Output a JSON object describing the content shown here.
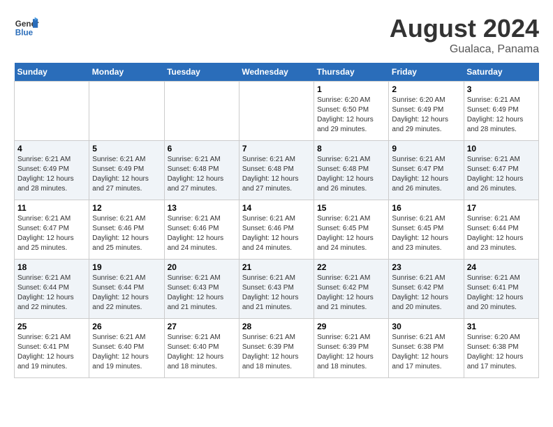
{
  "header": {
    "logo_line1": "General",
    "logo_line2": "Blue",
    "month_year": "August 2024",
    "location": "Gualaca, Panama"
  },
  "days_of_week": [
    "Sunday",
    "Monday",
    "Tuesday",
    "Wednesday",
    "Thursday",
    "Friday",
    "Saturday"
  ],
  "weeks": [
    [
      {
        "day": "",
        "sunrise": "",
        "sunset": "",
        "daylight": ""
      },
      {
        "day": "",
        "sunrise": "",
        "sunset": "",
        "daylight": ""
      },
      {
        "day": "",
        "sunrise": "",
        "sunset": "",
        "daylight": ""
      },
      {
        "day": "",
        "sunrise": "",
        "sunset": "",
        "daylight": ""
      },
      {
        "day": "1",
        "sunrise": "6:20 AM",
        "sunset": "6:50 PM",
        "daylight": "12 hours and 29 minutes."
      },
      {
        "day": "2",
        "sunrise": "6:20 AM",
        "sunset": "6:49 PM",
        "daylight": "12 hours and 29 minutes."
      },
      {
        "day": "3",
        "sunrise": "6:21 AM",
        "sunset": "6:49 PM",
        "daylight": "12 hours and 28 minutes."
      }
    ],
    [
      {
        "day": "4",
        "sunrise": "6:21 AM",
        "sunset": "6:49 PM",
        "daylight": "12 hours and 28 minutes."
      },
      {
        "day": "5",
        "sunrise": "6:21 AM",
        "sunset": "6:49 PM",
        "daylight": "12 hours and 27 minutes."
      },
      {
        "day": "6",
        "sunrise": "6:21 AM",
        "sunset": "6:48 PM",
        "daylight": "12 hours and 27 minutes."
      },
      {
        "day": "7",
        "sunrise": "6:21 AM",
        "sunset": "6:48 PM",
        "daylight": "12 hours and 27 minutes."
      },
      {
        "day": "8",
        "sunrise": "6:21 AM",
        "sunset": "6:48 PM",
        "daylight": "12 hours and 26 minutes."
      },
      {
        "day": "9",
        "sunrise": "6:21 AM",
        "sunset": "6:47 PM",
        "daylight": "12 hours and 26 minutes."
      },
      {
        "day": "10",
        "sunrise": "6:21 AM",
        "sunset": "6:47 PM",
        "daylight": "12 hours and 26 minutes."
      }
    ],
    [
      {
        "day": "11",
        "sunrise": "6:21 AM",
        "sunset": "6:47 PM",
        "daylight": "12 hours and 25 minutes."
      },
      {
        "day": "12",
        "sunrise": "6:21 AM",
        "sunset": "6:46 PM",
        "daylight": "12 hours and 25 minutes."
      },
      {
        "day": "13",
        "sunrise": "6:21 AM",
        "sunset": "6:46 PM",
        "daylight": "12 hours and 24 minutes."
      },
      {
        "day": "14",
        "sunrise": "6:21 AM",
        "sunset": "6:46 PM",
        "daylight": "12 hours and 24 minutes."
      },
      {
        "day": "15",
        "sunrise": "6:21 AM",
        "sunset": "6:45 PM",
        "daylight": "12 hours and 24 minutes."
      },
      {
        "day": "16",
        "sunrise": "6:21 AM",
        "sunset": "6:45 PM",
        "daylight": "12 hours and 23 minutes."
      },
      {
        "day": "17",
        "sunrise": "6:21 AM",
        "sunset": "6:44 PM",
        "daylight": "12 hours and 23 minutes."
      }
    ],
    [
      {
        "day": "18",
        "sunrise": "6:21 AM",
        "sunset": "6:44 PM",
        "daylight": "12 hours and 22 minutes."
      },
      {
        "day": "19",
        "sunrise": "6:21 AM",
        "sunset": "6:44 PM",
        "daylight": "12 hours and 22 minutes."
      },
      {
        "day": "20",
        "sunrise": "6:21 AM",
        "sunset": "6:43 PM",
        "daylight": "12 hours and 21 minutes."
      },
      {
        "day": "21",
        "sunrise": "6:21 AM",
        "sunset": "6:43 PM",
        "daylight": "12 hours and 21 minutes."
      },
      {
        "day": "22",
        "sunrise": "6:21 AM",
        "sunset": "6:42 PM",
        "daylight": "12 hours and 21 minutes."
      },
      {
        "day": "23",
        "sunrise": "6:21 AM",
        "sunset": "6:42 PM",
        "daylight": "12 hours and 20 minutes."
      },
      {
        "day": "24",
        "sunrise": "6:21 AM",
        "sunset": "6:41 PM",
        "daylight": "12 hours and 20 minutes."
      }
    ],
    [
      {
        "day": "25",
        "sunrise": "6:21 AM",
        "sunset": "6:41 PM",
        "daylight": "12 hours and 19 minutes."
      },
      {
        "day": "26",
        "sunrise": "6:21 AM",
        "sunset": "6:40 PM",
        "daylight": "12 hours and 19 minutes."
      },
      {
        "day": "27",
        "sunrise": "6:21 AM",
        "sunset": "6:40 PM",
        "daylight": "12 hours and 18 minutes."
      },
      {
        "day": "28",
        "sunrise": "6:21 AM",
        "sunset": "6:39 PM",
        "daylight": "12 hours and 18 minutes."
      },
      {
        "day": "29",
        "sunrise": "6:21 AM",
        "sunset": "6:39 PM",
        "daylight": "12 hours and 18 minutes."
      },
      {
        "day": "30",
        "sunrise": "6:21 AM",
        "sunset": "6:38 PM",
        "daylight": "12 hours and 17 minutes."
      },
      {
        "day": "31",
        "sunrise": "6:20 AM",
        "sunset": "6:38 PM",
        "daylight": "12 hours and 17 minutes."
      }
    ]
  ]
}
